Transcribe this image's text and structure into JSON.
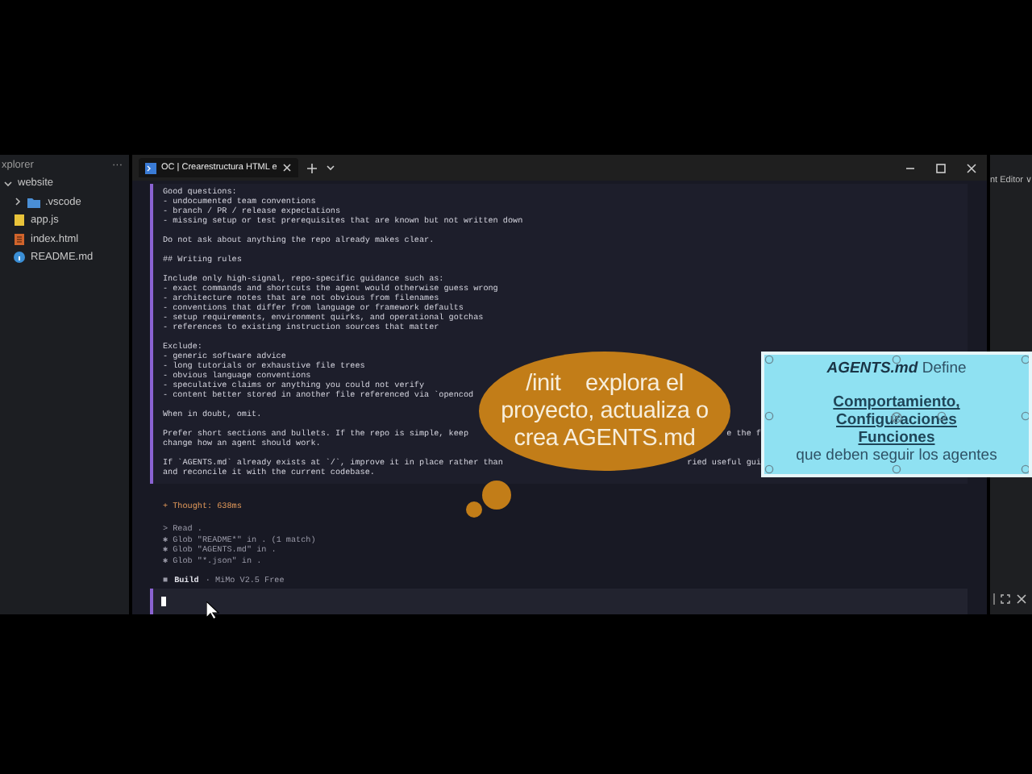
{
  "explorer": {
    "title": "xplorer",
    "more": "···",
    "items": [
      {
        "label": "website",
        "expanded": true,
        "children": [
          {
            "label": ".vscode",
            "kind": "folder",
            "expanded": false
          },
          {
            "label": "app.js",
            "kind": "js"
          },
          {
            "label": "index.html",
            "kind": "html"
          },
          {
            "label": "README.md",
            "kind": "info"
          }
        ]
      }
    ]
  },
  "terminal": {
    "tab": {
      "title": "OC | Crearestructura HTML e",
      "selected": true
    },
    "message": [
      {
        "lines": [
          "Good questions:",
          "- undocumented team conventions",
          "- branch / PR / release expectations",
          "- missing setup or test prerequisites that are known but not written down"
        ]
      },
      {
        "lines": [
          "Do not ask about anything the repo already makes clear."
        ]
      },
      {
        "lines": [
          "## Writing rules"
        ]
      },
      {
        "lines": [
          "Include only high-signal, repo-specific guidance such as:",
          "- exact commands and shortcuts the agent would otherwise guess wrong",
          "- architecture notes that are not obvious from filenames",
          "- conventions that differ from language or framework defaults",
          "- setup requirements, environment quirks, and operational gotchas",
          "- references to existing instruction sources that matter"
        ]
      },
      {
        "lines": [
          "Exclude:",
          "- generic software advice",
          "- long tutorials or exhaustive file trees",
          "- obvious language conventions",
          "- speculative claims or anything you could not verify",
          "- content better stored in another file referenced via `opencod"
        ]
      },
      {
        "lines": [
          "When in doubt, omit."
        ]
      },
      {
        "lines": [
          {
            "text": "Prefer short sections and bullets. If the repo is simple, keep",
            "tail": "e the f"
          },
          "change how an agent should work."
        ]
      },
      {
        "lines": [
          {
            "text": "If `AGENTS.md` already exists at `/`, improve it in place rather than",
            "tail": "ried useful gui"
          },
          "and reconcile it with the current codebase."
        ]
      }
    ],
    "thought": "+ Thought: 638ms",
    "tools": [
      "> Read .",
      "✱ Glob \"README*\" in . (1 match)",
      "✱ Glob \"AGENTS.md\" in .",
      "✱ Glob \"*.json\" in ."
    ],
    "status": {
      "marker": "■",
      "mode": "Build",
      "model": "· MiMo V2.5 Free"
    }
  },
  "side_panel": {
    "title": "nt Editor ∨"
  },
  "callout": {
    "text": "/init    explora el\nproyecto, actualiza o\ncrea AGENTS.md"
  },
  "note": {
    "lines": [
      {
        "text": "**AGENTS.md**  Define",
        "kind": "plain"
      },
      {
        "text": "Comportamiento,",
        "kind": "emphasis"
      },
      {
        "text": "Configuraciones",
        "kind": "emphasis"
      },
      {
        "text": "Funciones",
        "kind": "emphasis"
      },
      {
        "text": "que deben seguir los agentes",
        "kind": "plain"
      }
    ]
  }
}
